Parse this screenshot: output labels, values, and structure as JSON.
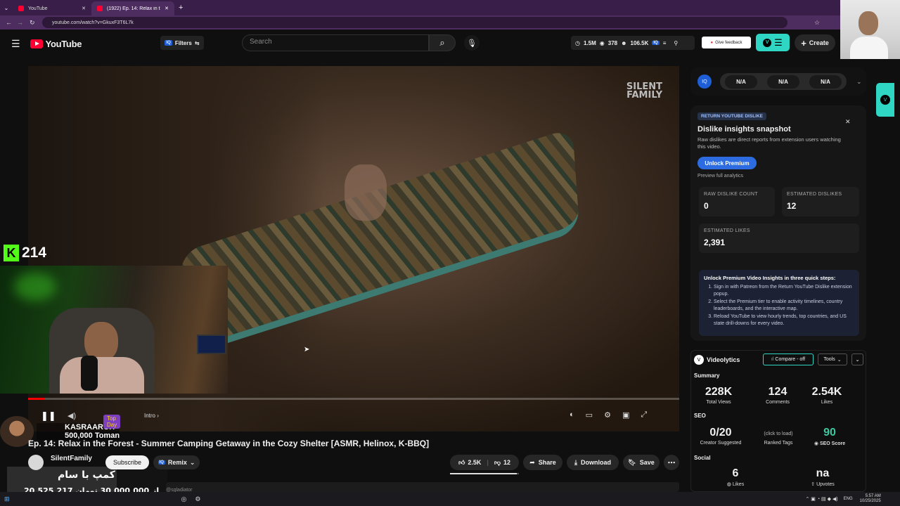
{
  "browser": {
    "tabs": [
      {
        "label": "YouTube"
      },
      {
        "label": "(1922) Ep. 14: Relax in the F"
      }
    ],
    "url": "youtube.com/watch?v=GkuxF3T6L7k"
  },
  "header": {
    "logo": "YouTube",
    "filters_label": "Filters",
    "search_placeholder": "Search",
    "stats": {
      "views": "1.5M",
      "eye": "378",
      "subs": "106.5K"
    },
    "feedback_label": "Give feedback",
    "create_label": "Create"
  },
  "video": {
    "watermark_top": "SILENT",
    "watermark_bottom": "FAMILY",
    "title": "Ep. 14: Relax in the Forest - Summer Camping Getaway in the Cozy Shelter [ASMR, Helinox, K-BBQ]",
    "chapter": "Intro",
    "channel": "SilentFamily",
    "subscribe": "Subscribe",
    "remix": "Remix",
    "likes": "2.5K",
    "dislikes": "12",
    "share": "Share",
    "download": "Download",
    "save": "Save",
    "comment_preview": "@sgladiator"
  },
  "overlays": {
    "k_count": "214",
    "donor_name": "KASRAAROX",
    "donor_amount": "500,000 Toman",
    "top_day": "Top Day",
    "goal_title": "کمپ با سام",
    "goal_progress": "20,525,217 از 30,000,000 تومان",
    "goal_fraction": 0.684
  },
  "rq_bar": {
    "values": [
      "N/A",
      "N/A",
      "N/A"
    ]
  },
  "ryd": {
    "badge": "RETURN YOUTUBE DISLIKE",
    "title": "Dislike insights snapshot",
    "desc": "Raw dislikes are direct reports from extension users watching this video.",
    "unlock_btn": "Unlock Premium",
    "preview": "Preview full analytics",
    "raw_label": "RAW DISLIKE COUNT",
    "raw_value": "0",
    "est_dis_label": "ESTIMATED DISLIKES",
    "est_dis_value": "12",
    "est_likes_label": "ESTIMATED LIKES",
    "est_likes_value": "2,391",
    "steps_title": "Unlock Premium Video Insights in three quick steps:",
    "steps": [
      "Sign in with Patreon from the Return YouTube Dislike extension popup.",
      "Select the Premium tier to enable activity timelines, country leaderboards, and the interactive map.",
      "Reload YouTube to view hourly trends, top countries, and US state drill-downs for every video."
    ]
  },
  "videolytics": {
    "title": "Videolytics",
    "compare": "Compare - off",
    "tools": "Tools",
    "summary_label": "Summary",
    "views": "228K",
    "views_label": "Total Views",
    "comments": "124",
    "comments_label": "Comments",
    "likes": "2.54K",
    "likes_label": "Likes",
    "seo_label": "SEO",
    "tags": "0/20",
    "tags_label": "Creator Suggested",
    "ranked": "(click to load)",
    "ranked_label": "Ranked Tags",
    "score": "90",
    "score_label": "SEO Score",
    "social_label": "Social",
    "s_likes": "6",
    "s_likes_label": "Likes",
    "upvotes": "na",
    "upvotes_label": "Upvotes"
  },
  "taskbar": {
    "lang": "ENG",
    "time": "5:57 AM",
    "date": "10/25/2025"
  }
}
